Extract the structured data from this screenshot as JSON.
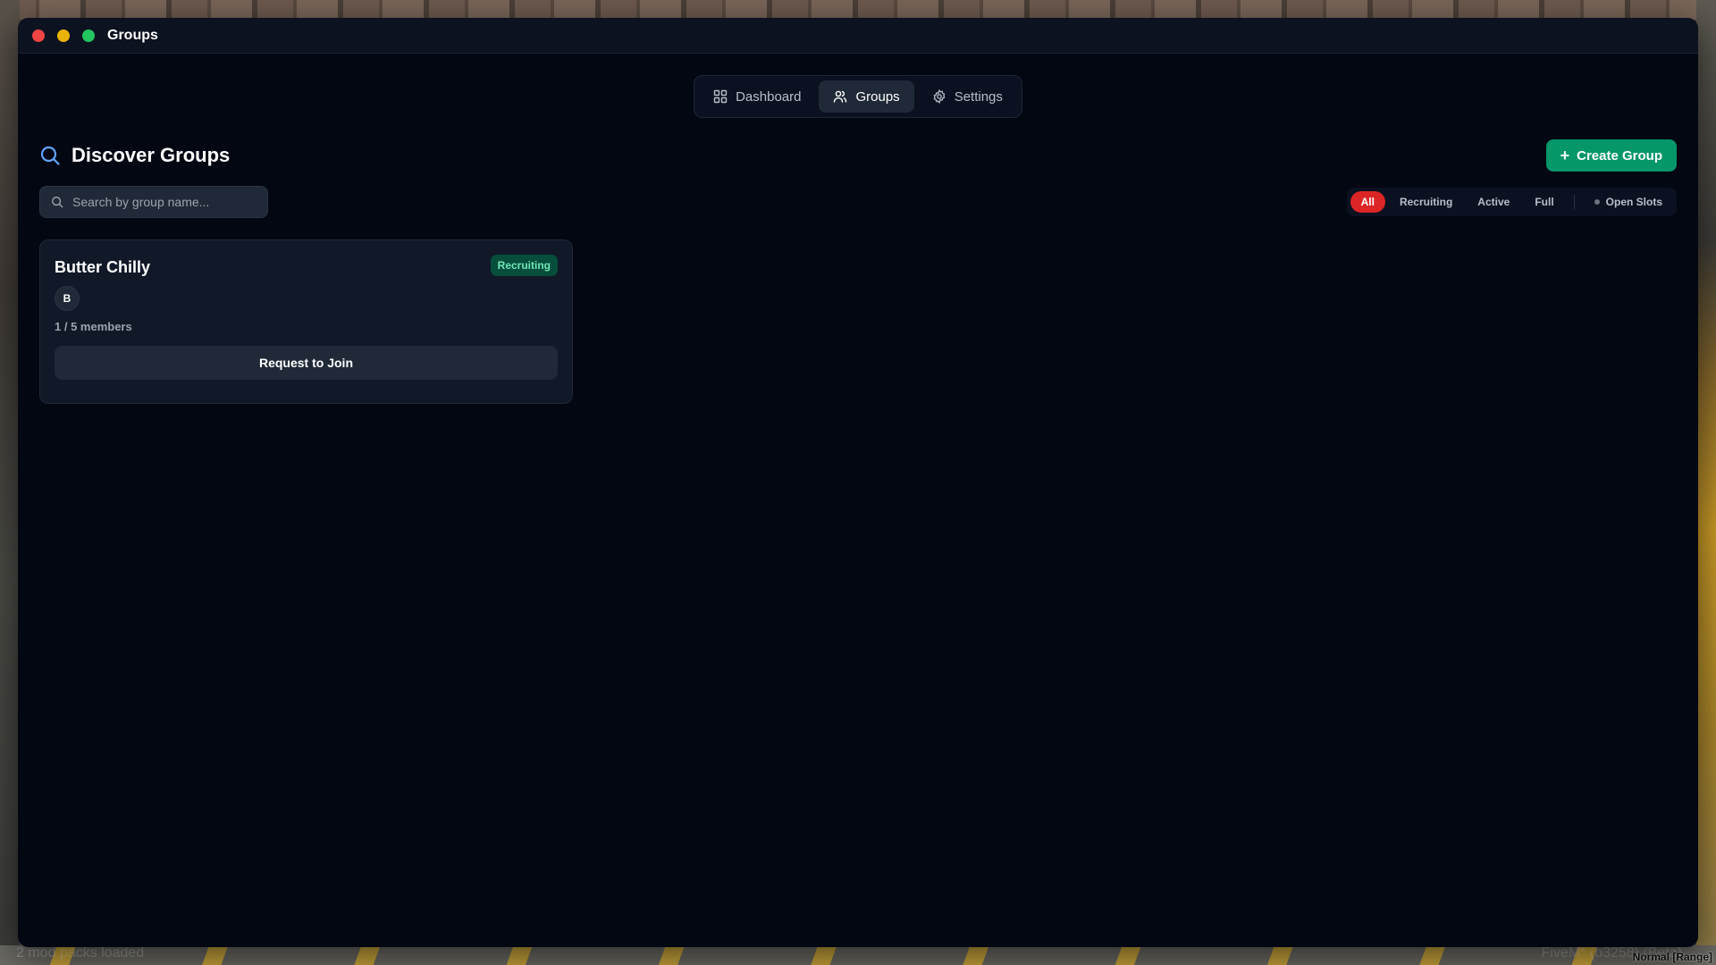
{
  "window": {
    "title": "Groups"
  },
  "nav": {
    "items": [
      {
        "label": "Dashboard",
        "icon": "grid-icon"
      },
      {
        "label": "Groups",
        "icon": "users-icon",
        "active": true
      },
      {
        "label": "Settings",
        "icon": "gear-icon"
      }
    ]
  },
  "header": {
    "title": "Discover Groups",
    "create_label": "Create Group"
  },
  "search": {
    "placeholder": "Search by group name...",
    "value": ""
  },
  "filters": {
    "items": [
      {
        "label": "All",
        "active": true
      },
      {
        "label": "Recruiting"
      },
      {
        "label": "Active"
      },
      {
        "label": "Full"
      }
    ],
    "open_slots_label": "Open Slots"
  },
  "groups": [
    {
      "name": "Butter Chilly",
      "status": "Recruiting",
      "avatar_initial": "B",
      "members_text": "1 / 5 members",
      "action_label": "Request to Join"
    }
  ],
  "hud": {
    "left_text": "2 mod packs loaded",
    "right_text": "FiveM* (b3258) (Beta)",
    "mode_text": "Normal [Range]"
  },
  "colors": {
    "accent_green": "#059669",
    "filter_active": "#dc2626",
    "window_bg": "#030712",
    "card_bg": "#111827",
    "badge_text": "#6ee7b7"
  }
}
